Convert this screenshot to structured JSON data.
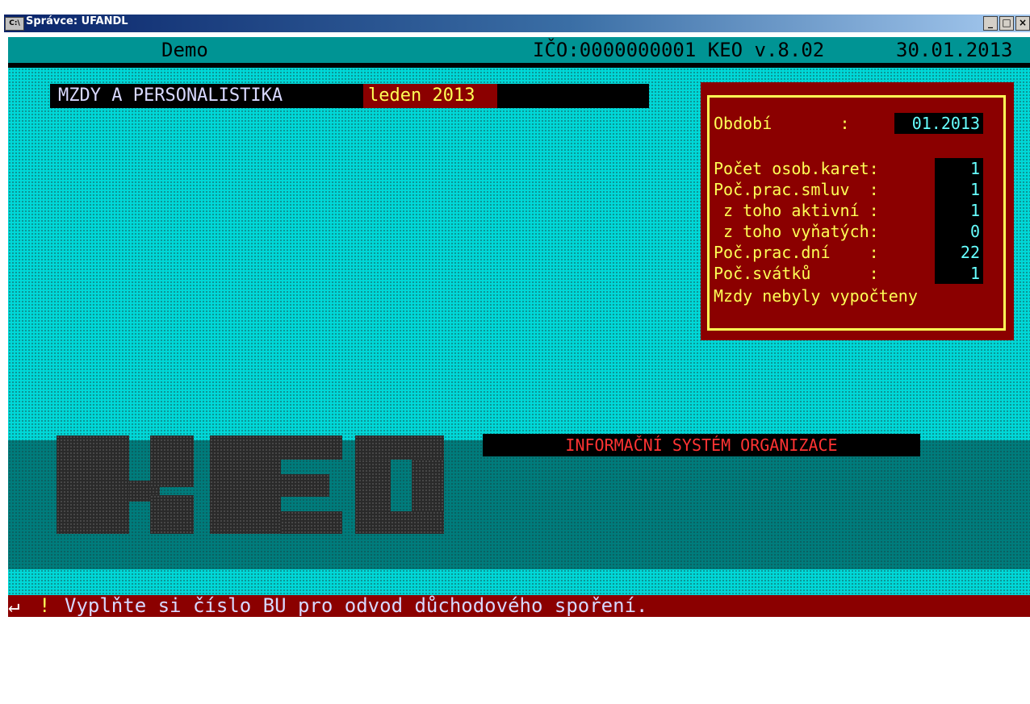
{
  "window": {
    "title": "Správce: UFANDL",
    "icon": "console-icon",
    "buttons": [
      "_",
      "□",
      "×"
    ]
  },
  "topbar": {
    "company": "Demo",
    "ico_version": "IČO:0000000001 KEO v.8.02",
    "date": "30.01.2013"
  },
  "header": {
    "module": "MZDY A PERSONALISTIKA",
    "period_text": "leden 2013"
  },
  "info": {
    "obdobi_label": "Období       :",
    "obdobi_value": "01.2013",
    "rows": [
      {
        "label": "Počet osob.karet:",
        "value": "1"
      },
      {
        "label": "Poč.prac.smluv  :",
        "value": "1"
      },
      {
        "label": " z toho aktivní :",
        "value": "1"
      },
      {
        "label": " z toho vyňatých:",
        "value": "0"
      },
      {
        "label": "Poč.prac.dní    :",
        "value": "22"
      },
      {
        "label": "Poč.svátků      :",
        "value": "1"
      }
    ],
    "status": "Mzdy nebyly vypočteny"
  },
  "logo": {
    "text": "KEO"
  },
  "subtitle": "INFORMAČNÍ SYSTÉM ORGANIZACE",
  "statusbar": {
    "arrow": "↵",
    "alert": "!",
    "message": "Vyplňte si číslo BU pro odvod důchodového spoření."
  },
  "colors": {
    "console_cyan": "#00d8d8",
    "console_teal": "#007c7c",
    "panel_red": "#8b0000",
    "label_yellow": "#ffff55"
  }
}
